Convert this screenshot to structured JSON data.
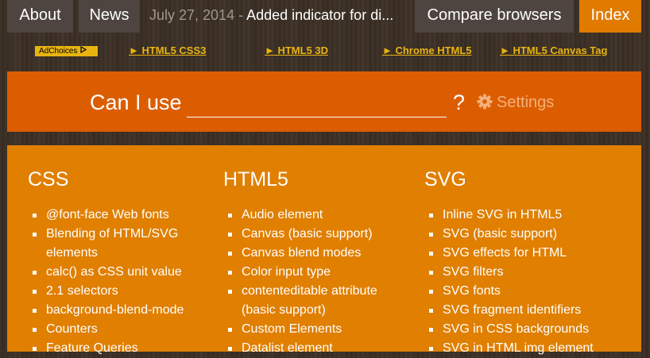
{
  "nav": {
    "about": "About",
    "news": "News",
    "news_date": "July 27, 2014 - ",
    "news_text": "Added indicator for di...",
    "compare": "Compare browsers",
    "index": "Index"
  },
  "ads": {
    "adchoices": "AdChoices",
    "links": [
      "► HTML5 CSS3",
      "► HTML5 3D",
      "► Chrome HTML5",
      "► HTML5 Canvas Tag"
    ]
  },
  "search": {
    "label": "Can I use",
    "value": "",
    "question": "?",
    "settings": "Settings"
  },
  "columns": {
    "css": {
      "title": "CSS",
      "items": [
        "@font-face Web fonts",
        "Blending of HTML/SVG elements",
        "calc() as CSS unit value",
        "2.1 selectors",
        "background-blend-mode",
        "Counters",
        "Feature Queries"
      ]
    },
    "html5": {
      "title": "HTML5",
      "items": [
        "Audio element",
        "Canvas (basic support)",
        "Canvas blend modes",
        "Color input type",
        "contenteditable attribute (basic support)",
        "Custom Elements",
        "Datalist element"
      ]
    },
    "svg": {
      "title": "SVG",
      "items": [
        "Inline SVG in HTML5",
        "SVG (basic support)",
        "SVG effects for HTML",
        "SVG filters",
        "SVG fonts",
        "SVG fragment identifiers",
        "SVG in CSS backgrounds",
        "SVG in HTML img element"
      ]
    }
  },
  "colors": {
    "nav_button": "#4e4540",
    "index_active": "#e07b00",
    "search_panel": "#dc5d00",
    "features_panel": "#e07f00",
    "ad_link": "#e8b410"
  },
  "icons": {
    "settings": "gear-icon",
    "adchoices": "adchoices-icon"
  }
}
